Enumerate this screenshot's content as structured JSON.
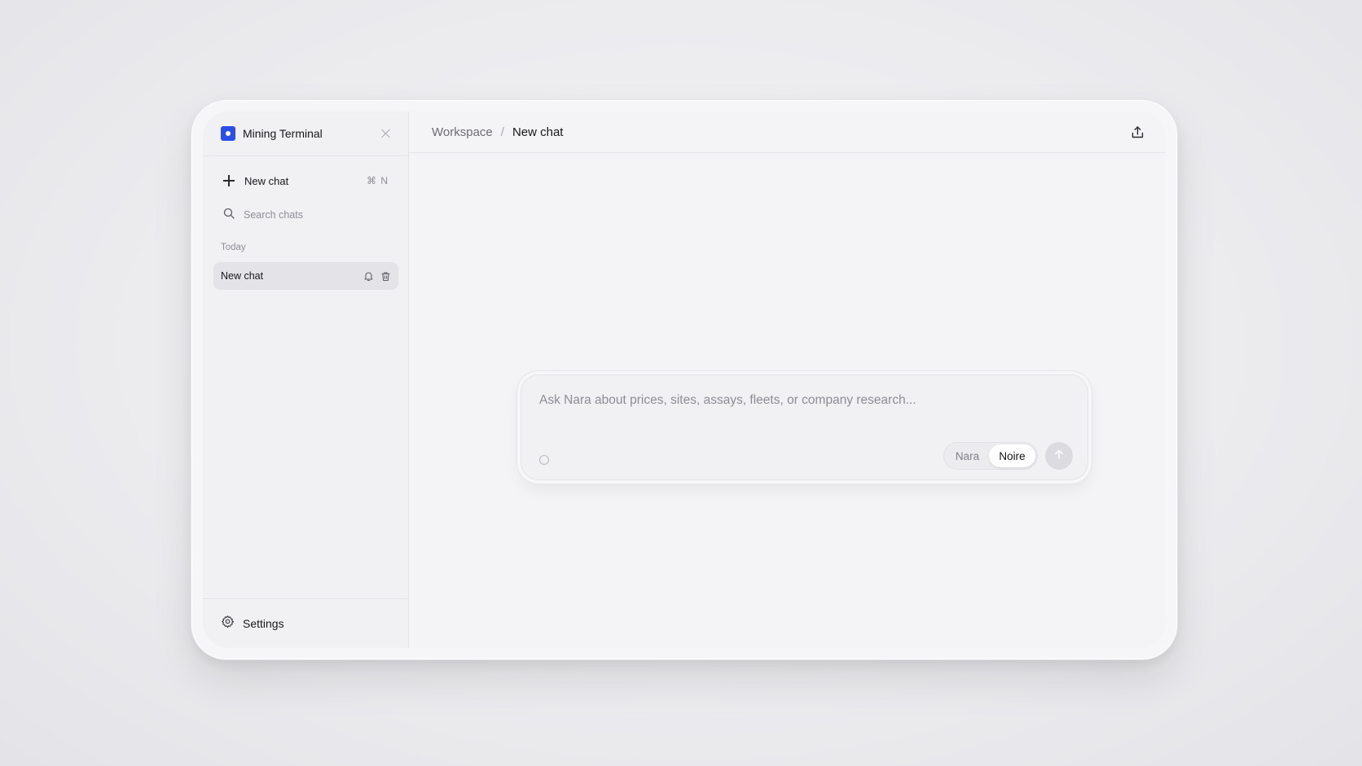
{
  "sidebar": {
    "app_title": "Mining Terminal",
    "new_chat_label": "New chat",
    "new_chat_shortcut": "⌘ N",
    "search_placeholder": "Search chats",
    "section_today": "Today",
    "chats": [
      {
        "label": "New chat"
      }
    ],
    "settings_label": "Settings",
    "brand_color": "#2b4ee8"
  },
  "header": {
    "breadcrumb_root": "Workspace",
    "breadcrumb_separator": "/",
    "breadcrumb_current": "New chat"
  },
  "composer": {
    "placeholder": "Ask Nara about prices, sites, assays, fleets, or company research...",
    "models": [
      "Nara",
      "Noire"
    ],
    "selected_model": "Noire"
  },
  "icons": {
    "close": "close-icon",
    "new_chat": "plus-icon",
    "search": "search-icon",
    "pin": "bell-icon",
    "delete": "trash-icon",
    "settings": "gear-icon",
    "share": "share-icon",
    "attach": "attach-icon",
    "send": "arrow-up-icon"
  }
}
